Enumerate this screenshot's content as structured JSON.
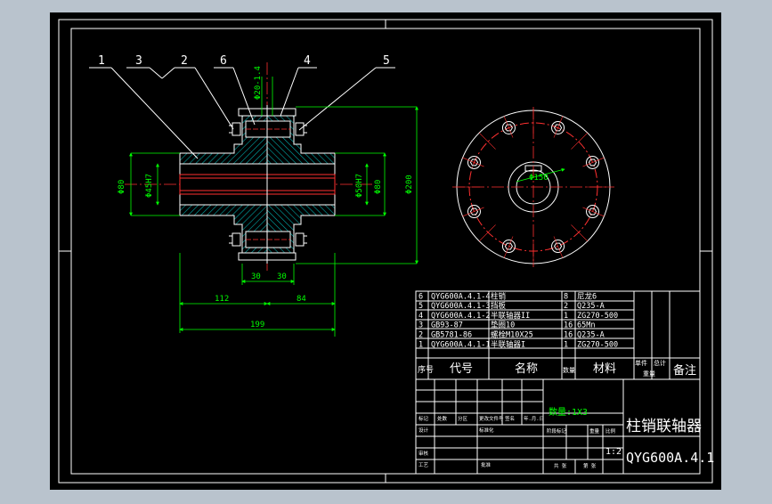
{
  "title": {
    "name": "柱销联轴器",
    "code": "QYG600A.4.1",
    "quantity": "数量:1X3",
    "scale": "1:2"
  },
  "balloons": [
    "1",
    "3",
    "2",
    "6",
    "4",
    "5"
  ],
  "dimensions": {
    "d_bolt": "Φ20-1.4",
    "d_left_outer": "Φ80",
    "d_left_bore": "Φ45H7",
    "d_right_bore": "Φ50H7",
    "d_right_outer": "Φ80",
    "d_flange": "Φ200",
    "len_left_flange": "30",
    "len_right_flange": "30",
    "len_left": "112",
    "len_right": "84",
    "len_total": "199",
    "side_circle": "Φ150"
  },
  "parts": [
    {
      "no": "6",
      "code": "QYG600A.4.1-4",
      "name": "柱销",
      "qty": "8",
      "material": "尼龙6"
    },
    {
      "no": "5",
      "code": "QYG600A.4.1-3",
      "name": "挡板",
      "qty": "2",
      "material": "Q235-A"
    },
    {
      "no": "4",
      "code": "QYG600A.4.1-2",
      "name": "半联轴器II",
      "qty": "1",
      "material": "ZG270-500"
    },
    {
      "no": "3",
      "code": "GB93-87",
      "name": "垫圈10",
      "qty": "16",
      "material": "65Mn"
    },
    {
      "no": "2",
      "code": "GB5781-86",
      "name": "螺栓M10X25",
      "qty": "16",
      "material": "Q235-A"
    },
    {
      "no": "1",
      "code": "QYG600A.4.1-1",
      "name": "半联轴器I",
      "qty": "1",
      "material": "ZG270-500"
    }
  ],
  "headers": {
    "no": "序号",
    "code": "代号",
    "name": "名称",
    "qty": "数量",
    "material": "材料",
    "unit_wt": "单件",
    "total_wt": "总计",
    "weight": "重量",
    "remark": "备注"
  },
  "tb_labels": {
    "mark": "标记",
    "count": "处数",
    "zone": "分区",
    "change_doc": "更改文件号",
    "sign": "签名",
    "date": "年.月.日",
    "stage": "阶段标记",
    "weight": "重量",
    "scale": "比例",
    "design": "设计",
    "standardize": "标准化",
    "review": "审核",
    "process": "工艺",
    "approve": "批准",
    "total_sheets": "共 张",
    "sheet": "第 张"
  }
}
